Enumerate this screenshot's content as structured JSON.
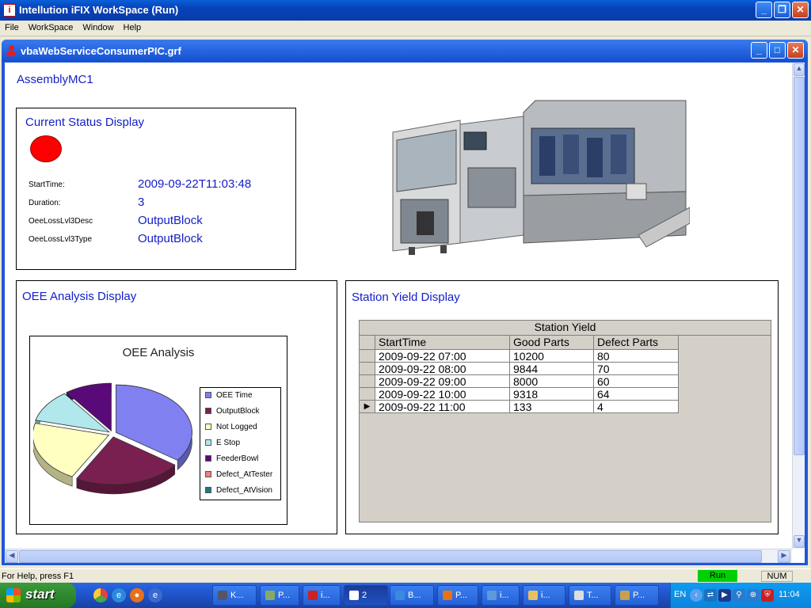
{
  "app": {
    "title": "Intellution iFIX WorkSpace (Run)",
    "icon": "ifix-app-icon"
  },
  "menu": {
    "items": [
      "File",
      "WorkSpace",
      "Window",
      "Help"
    ]
  },
  "document": {
    "title": "vbaWebServiceConsumerPIC.grf",
    "heading": "AssemblyMC1"
  },
  "status_panel": {
    "title": "Current Status Display",
    "indicator_color": "#ff0000",
    "fields": [
      {
        "label": "StartTime:",
        "value": "2009-09-22T11:03:48"
      },
      {
        "label": "Duration:",
        "value": "3"
      },
      {
        "label": "OeeLossLvl3Desc",
        "value": "OutputBlock"
      },
      {
        "label": "OeeLossLvl3Type",
        "value": "OutputBlock"
      }
    ]
  },
  "oee_panel": {
    "title": "OEE Analysis Display"
  },
  "chart_data": {
    "type": "pie",
    "title": "OEE Analysis",
    "legend_position": "right",
    "categories": [
      "OEE Time",
      "OutputBlock",
      "Not Logged",
      "E Stop",
      "FeederBowl",
      "Defect_AtTester",
      "Defect_AtVision"
    ],
    "values": [
      35,
      23,
      21,
      11,
      10,
      0,
      0
    ],
    "colors": [
      "#8080f0",
      "#7a2050",
      "#ffffc0",
      "#b0e8ec",
      "#5a0a78",
      "#f08080",
      "#207880"
    ]
  },
  "yield_panel": {
    "title": "Station Yield Display",
    "grid_title": "Station Yield",
    "columns": [
      "StartTime",
      "Good Parts",
      "Defect Parts"
    ],
    "rows": [
      [
        "2009-09-22  07:00",
        "10200",
        "80"
      ],
      [
        "2009-09-22  08:00",
        "9844",
        "70"
      ],
      [
        "2009-09-22  09:00",
        "8000",
        "60"
      ],
      [
        "2009-09-22  10:00",
        "9318",
        "64"
      ],
      [
        "2009-09-22  11:00",
        "133",
        "4"
      ]
    ],
    "current_row_marker": "▶"
  },
  "statusbar": {
    "help": "For Help, press F1",
    "mode": "Run",
    "num": "NUM",
    "mode_color": "#00d000"
  },
  "taskbar": {
    "start": "start",
    "tasks": [
      "K...",
      "P...",
      "i...",
      "2",
      "B...",
      "P...",
      "i...",
      "i...",
      "T...",
      "P..."
    ],
    "language": "EN",
    "clock": "11:04"
  }
}
